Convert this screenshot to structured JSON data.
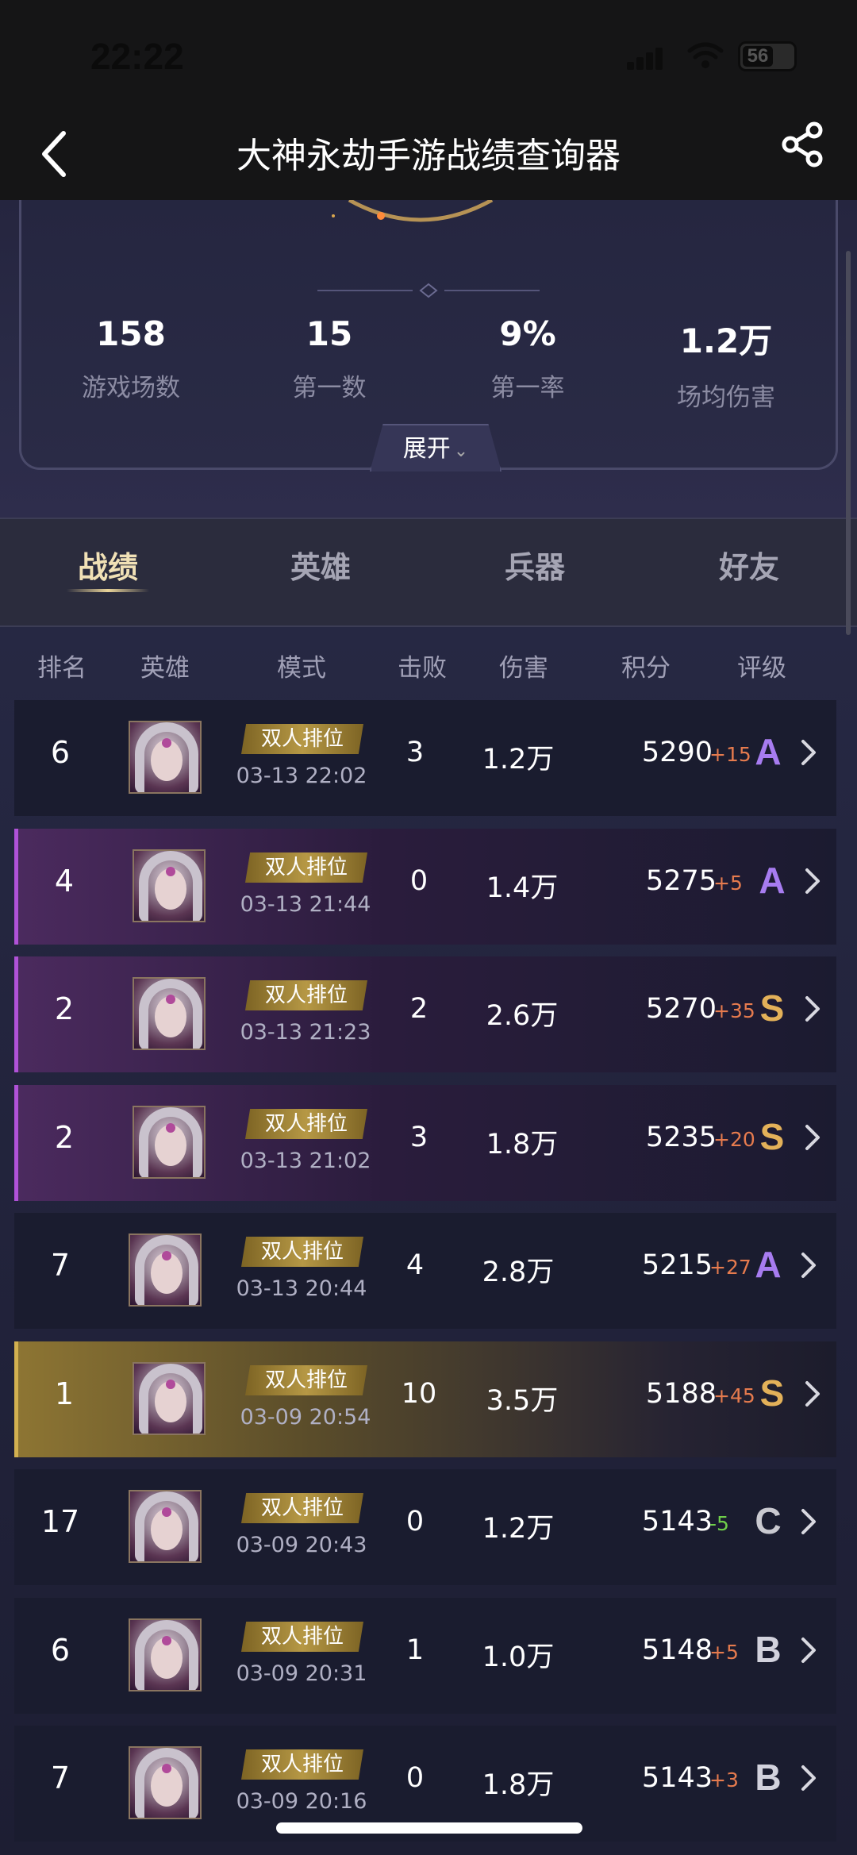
{
  "status_bar": {
    "time": "22:22",
    "battery": "56"
  },
  "nav": {
    "title": "大神永劫手游战绩查询器"
  },
  "stats": [
    {
      "value": "158",
      "label": "游戏场数"
    },
    {
      "value": "15",
      "label": "第一数"
    },
    {
      "value": "9%",
      "label": "第一率"
    },
    {
      "value": "1.2万",
      "label": "场均伤害"
    }
  ],
  "expand_label": "展开",
  "tabs": [
    "战绩",
    "英雄",
    "兵器",
    "好友"
  ],
  "active_tab": "战绩",
  "columns": [
    "排名",
    "英雄",
    "模式",
    "击败",
    "伤害",
    "积分",
    "评级"
  ],
  "rows": [
    {
      "rank": "6",
      "mode": "双人排位",
      "datetime": "03-13 22:02",
      "kills": "3",
      "damage": "1.2万",
      "score": "5290",
      "delta": "+15",
      "grade": "A",
      "style": "default"
    },
    {
      "rank": "4",
      "mode": "双人排位",
      "datetime": "03-13 21:44",
      "kills": "0",
      "damage": "1.4万",
      "score": "5275",
      "delta": "+5",
      "grade": "A",
      "style": "purple"
    },
    {
      "rank": "2",
      "mode": "双人排位",
      "datetime": "03-13 21:23",
      "kills": "2",
      "damage": "2.6万",
      "score": "5270",
      "delta": "+35",
      "grade": "S",
      "style": "purple"
    },
    {
      "rank": "2",
      "mode": "双人排位",
      "datetime": "03-13 21:02",
      "kills": "3",
      "damage": "1.8万",
      "score": "5235",
      "delta": "+20",
      "grade": "S",
      "style": "purple"
    },
    {
      "rank": "7",
      "mode": "双人排位",
      "datetime": "03-13 20:44",
      "kills": "4",
      "damage": "2.8万",
      "score": "5215",
      "delta": "+27",
      "grade": "A",
      "style": "default"
    },
    {
      "rank": "1",
      "mode": "双人排位",
      "datetime": "03-09 20:54",
      "kills": "10",
      "damage": "3.5万",
      "score": "5188",
      "delta": "+45",
      "grade": "S",
      "style": "gold"
    },
    {
      "rank": "17",
      "mode": "双人排位",
      "datetime": "03-09 20:43",
      "kills": "0",
      "damage": "1.2万",
      "score": "5143",
      "delta": "-5",
      "grade": "C",
      "style": "default"
    },
    {
      "rank": "6",
      "mode": "双人排位",
      "datetime": "03-09 20:31",
      "kills": "1",
      "damage": "1.0万",
      "score": "5148",
      "delta": "+5",
      "grade": "B",
      "style": "default"
    },
    {
      "rank": "7",
      "mode": "双人排位",
      "datetime": "03-09 20:16",
      "kills": "0",
      "damage": "1.8万",
      "score": "5143",
      "delta": "+3",
      "grade": "B",
      "style": "default"
    }
  ],
  "colors": {
    "grade_A": "#a77cf0",
    "grade_S": "#e3b159",
    "delta_positive": "#e67b4e",
    "delta_negative": "#6fcf4a",
    "purple_accent": "#b052d8",
    "gold_accent": "#d2b050"
  },
  "icons": {
    "back": "chevron-left-icon",
    "share": "share-icon",
    "row_arrow": "chevron-right-icon",
    "expand": "chevron-down-icon"
  }
}
